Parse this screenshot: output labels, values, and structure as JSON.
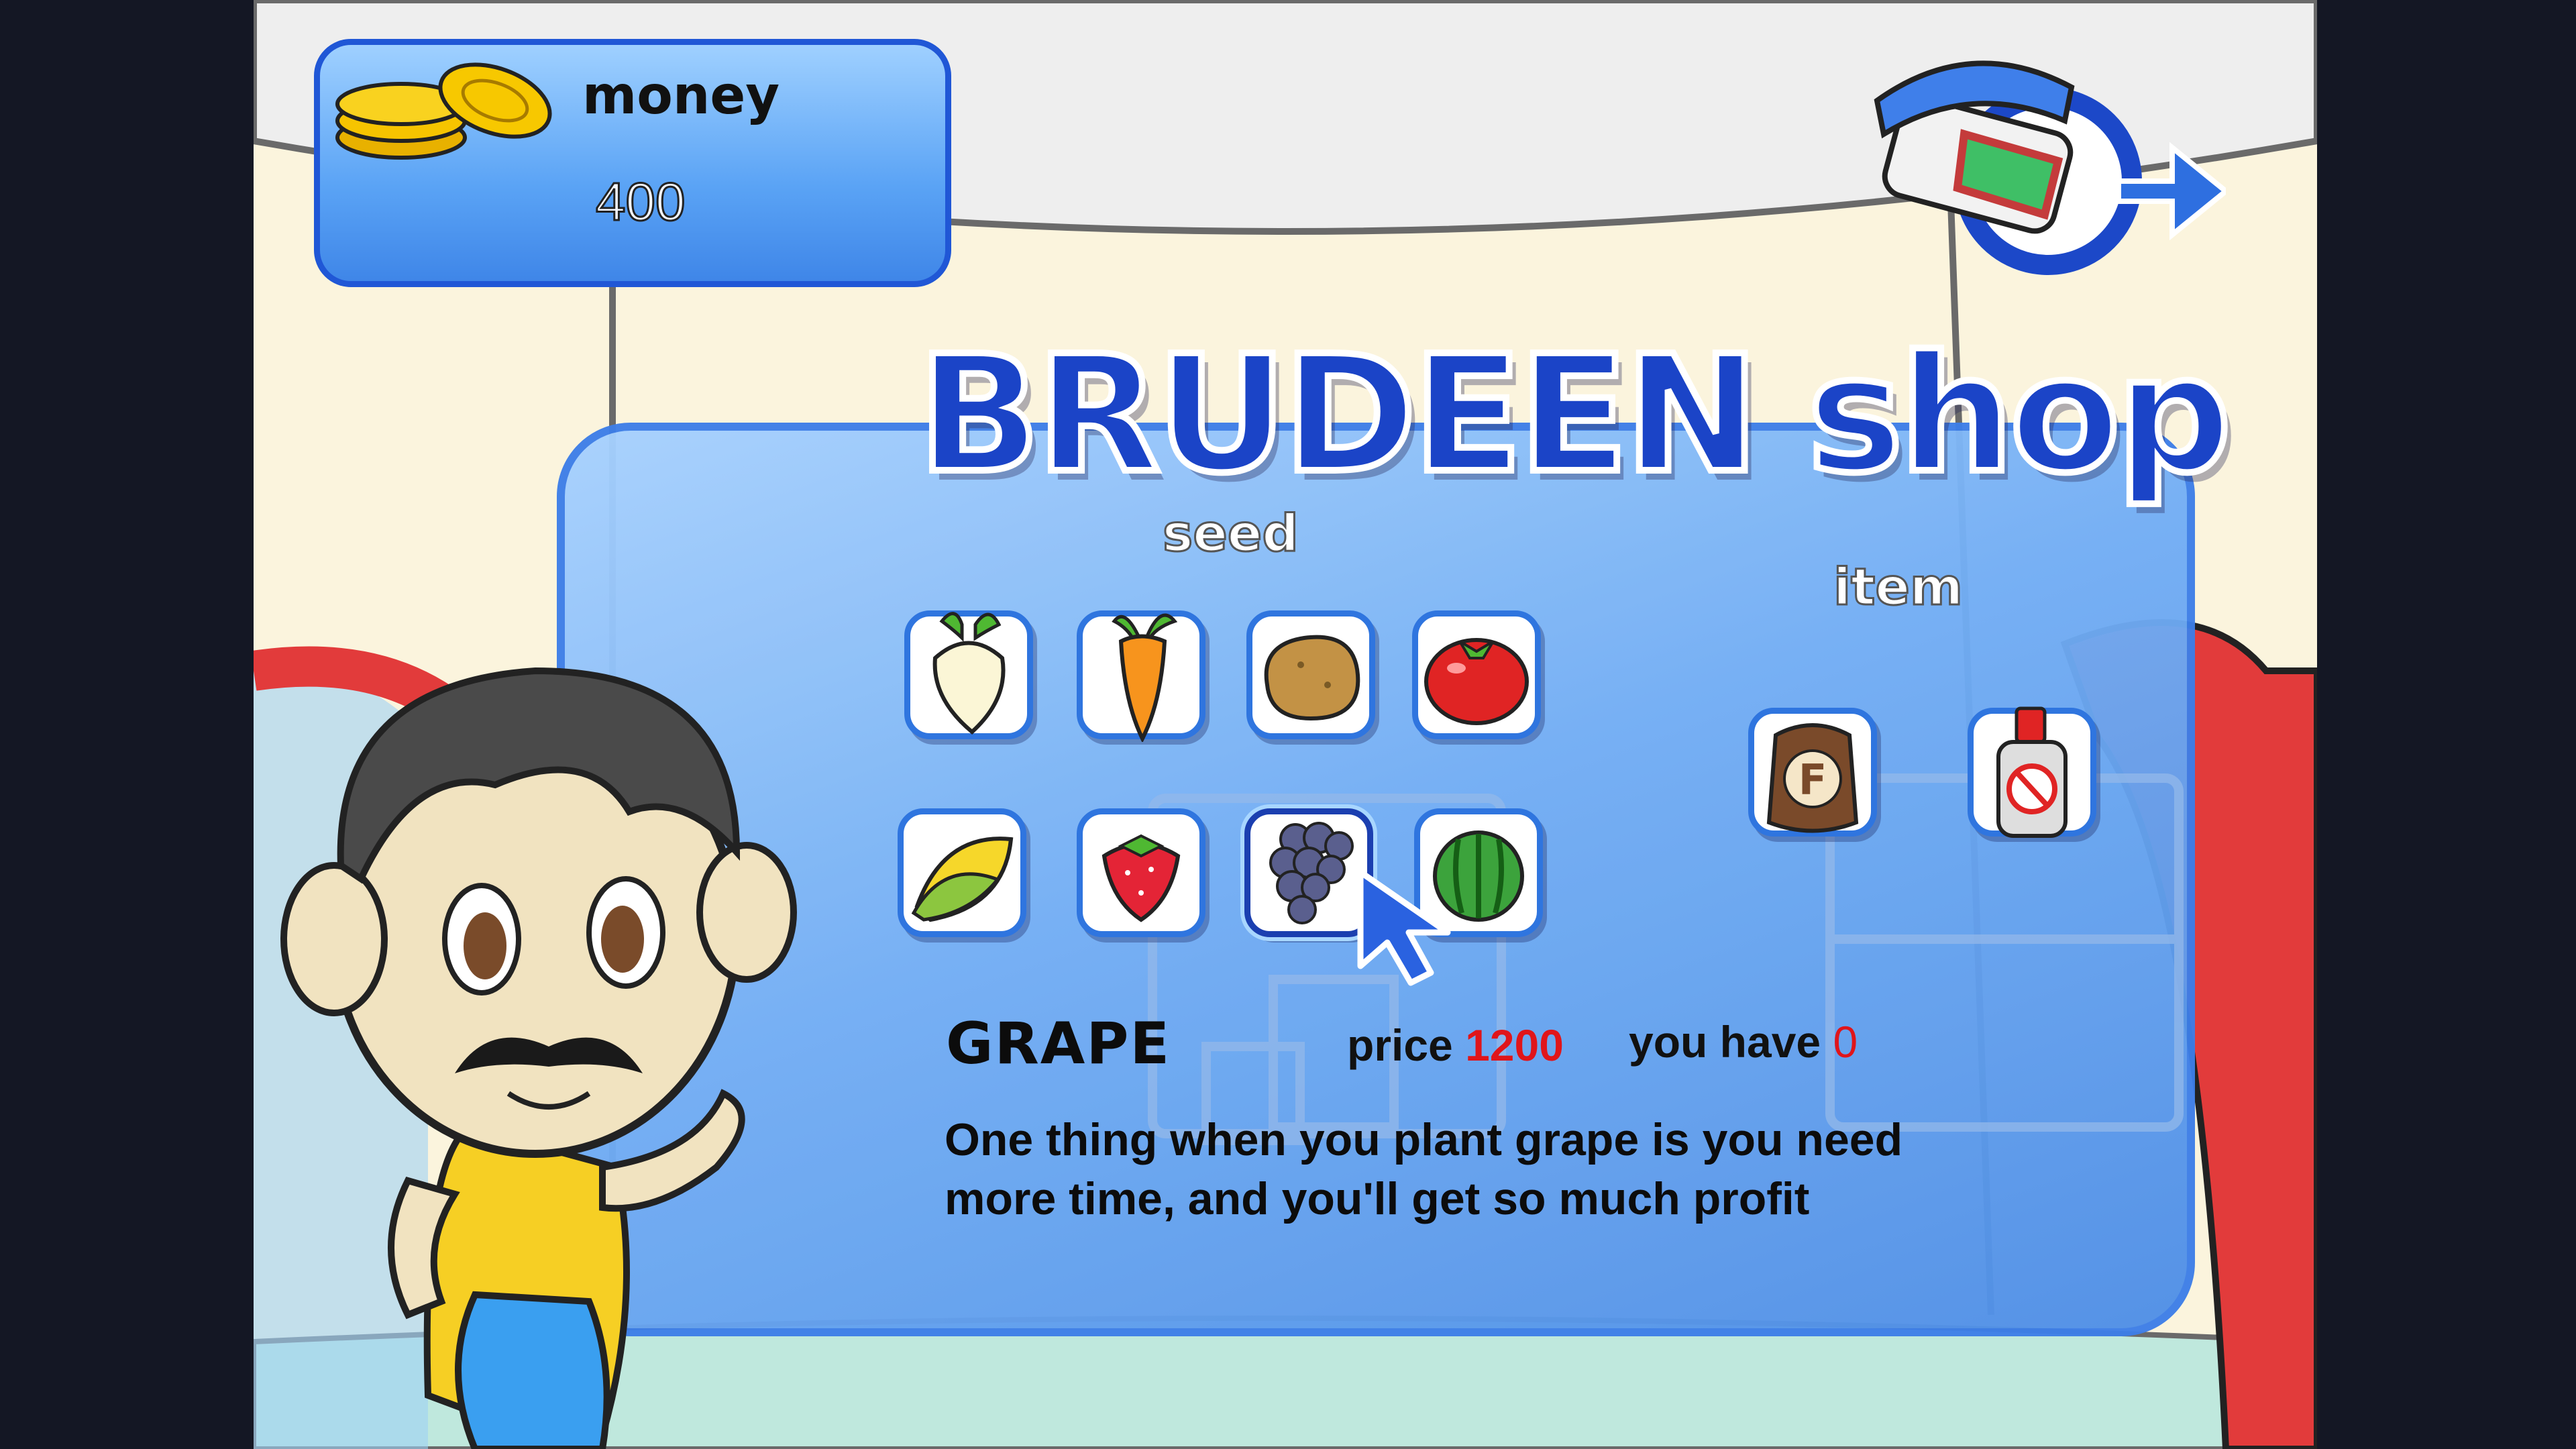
{
  "hud": {
    "money_label": "money",
    "money_value": "400"
  },
  "shop": {
    "title": "BRUDEEN shop",
    "seed_label": "seed",
    "item_label": "item",
    "seeds": [
      {
        "name": "radish-seed"
      },
      {
        "name": "carrot-seed"
      },
      {
        "name": "potato-seed"
      },
      {
        "name": "tomato-seed"
      },
      {
        "name": "corn-seed"
      },
      {
        "name": "strawberry-seed"
      },
      {
        "name": "grape-seed"
      },
      {
        "name": "watermelon-seed"
      }
    ],
    "items": [
      {
        "name": "fertilizer-bag"
      },
      {
        "name": "pesticide-bottle"
      }
    ],
    "selected": {
      "name": "GRAPE",
      "price_label": "price",
      "price_value": "1200",
      "have_label": "you have",
      "have_value": "0",
      "description": "One thing when you plant grape is you need more time, and you'll get  so much profit"
    }
  },
  "colors": {
    "accent": "#1b44c7",
    "panel": "#72aef5",
    "price": "#e0151a"
  }
}
